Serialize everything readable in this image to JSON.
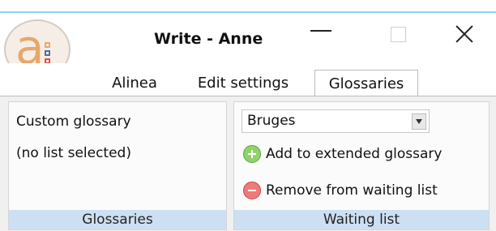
{
  "window": {
    "title": "Write - Anne",
    "controls": {
      "minimize_icon": "minimize-icon",
      "maximize_icon": "maximize-icon",
      "close_icon": "close-icon"
    }
  },
  "app_logo": {
    "letter": "a",
    "icon": "app-logo-icon",
    "colors": {
      "letter": "#e8a76a",
      "square_orange": "#e8a76a",
      "square_blue": "#4a6fb5",
      "square_red": "#d9534f"
    }
  },
  "tabs": [
    {
      "label": "Alinea",
      "active": false
    },
    {
      "label": "Edit settings",
      "active": false
    },
    {
      "label": "Glossaries",
      "active": true
    }
  ],
  "glossaries_group": {
    "custom_label": "Custom glossary",
    "status": "(no list selected)",
    "footer": "Glossaries"
  },
  "waiting_group": {
    "dropdown": {
      "selected": "Bruges"
    },
    "add_action": "Add to extended glossary",
    "remove_action": "Remove from waiting list",
    "footer": "Waiting list"
  },
  "colors": {
    "group_footer": "#cddff2",
    "ribbon_bg": "#f0f0f0",
    "accent_line": "#8ed3f0",
    "add_green": "#8fd36a",
    "remove_red": "#f07a7a"
  }
}
